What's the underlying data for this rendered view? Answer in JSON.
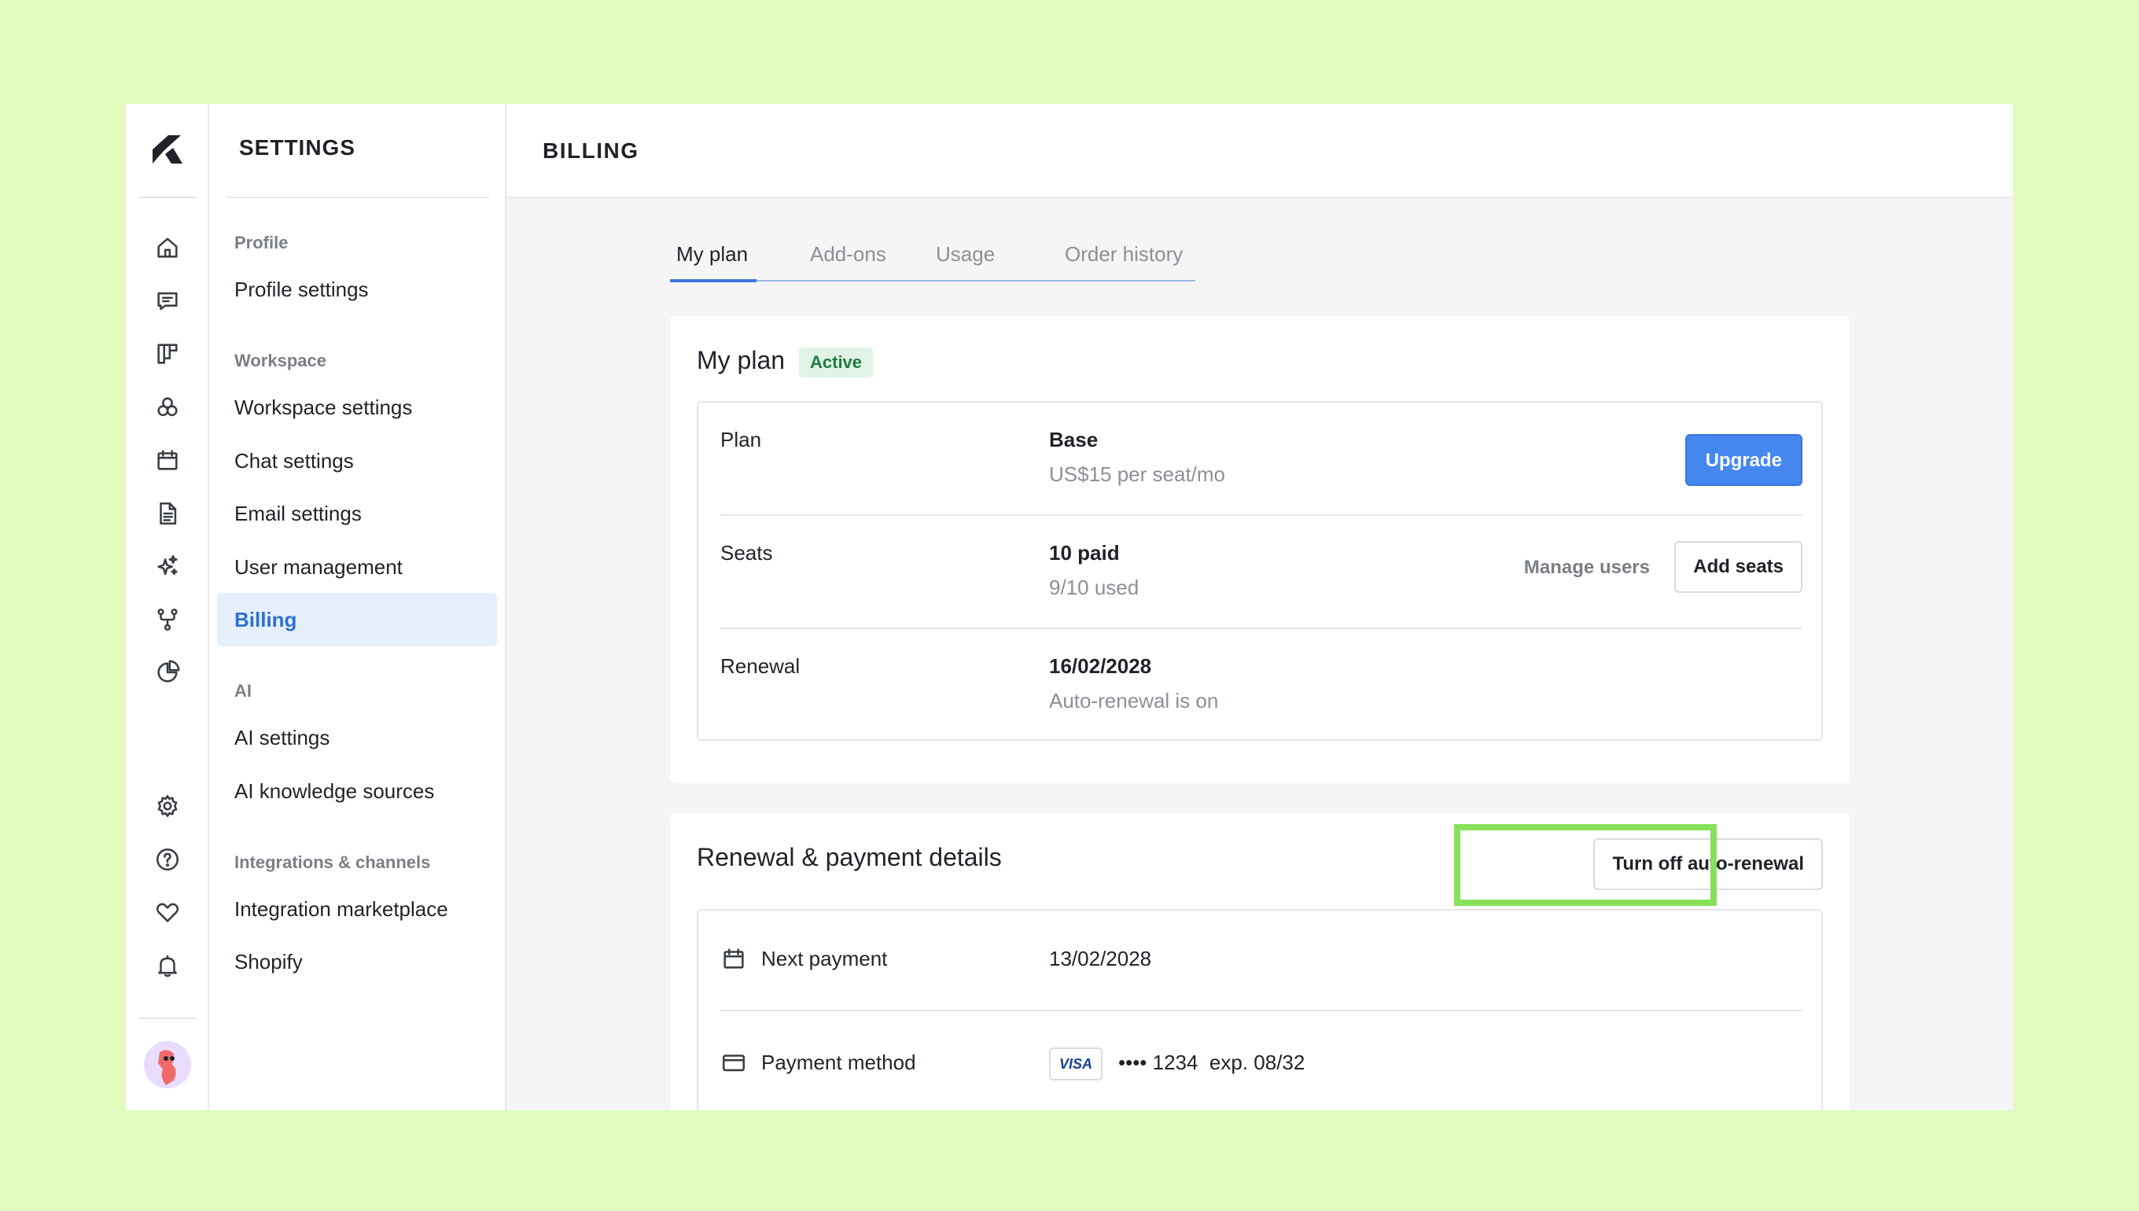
{
  "nav": {
    "title": "SETTINGS",
    "groups": [
      {
        "label": "Profile",
        "items": [
          "Profile settings"
        ]
      },
      {
        "label": "Workspace",
        "items": [
          "Workspace settings",
          "Chat settings",
          "Email settings",
          "User management",
          "Billing"
        ]
      },
      {
        "label": "AI",
        "items": [
          "AI settings",
          "AI knowledge sources"
        ]
      },
      {
        "label": "Integrations & channels",
        "items": [
          "Integration marketplace",
          "Shopify"
        ]
      }
    ],
    "active_item": "Billing"
  },
  "rail": {
    "icons": [
      "home-icon",
      "chat-icon",
      "board-icon",
      "circles-icon",
      "calendar-icon",
      "document-icon",
      "sparkles-icon",
      "workflow-icon",
      "pie-chart-icon",
      "gear-icon",
      "help-icon",
      "heart-icon",
      "bell-icon"
    ]
  },
  "header": {
    "title": "BILLING"
  },
  "tabs": [
    {
      "label": "My plan",
      "active": true
    },
    {
      "label": "Add-ons",
      "active": false
    },
    {
      "label": "Usage",
      "active": false
    },
    {
      "label": "Order history",
      "active": false
    }
  ],
  "plan_card": {
    "title": "My plan",
    "status": "Active",
    "rows": {
      "plan": {
        "label": "Plan",
        "value": "Base",
        "sub": "US$15 per seat/mo",
        "button": "Upgrade"
      },
      "seats": {
        "label": "Seats",
        "value": "10 paid",
        "sub": "9/10 used",
        "link": "Manage users",
        "button": "Add seats"
      },
      "renewal": {
        "label": "Renewal",
        "value": "16/02/2028",
        "sub": "Auto-renewal is on"
      }
    }
  },
  "payment_card": {
    "title": "Renewal & payment details",
    "button": "Turn off auto-renewal",
    "rows": {
      "next_payment": {
        "label": "Next payment",
        "value": "13/02/2028"
      },
      "payment_method": {
        "label": "Payment method",
        "brand": "VISA",
        "card": "•••• 1234  exp. 08/32"
      }
    }
  },
  "colors": {
    "accent": "#4587ee",
    "active_nav_bg": "#e6f0fd",
    "highlight": "#86e05a",
    "page_bg": "#e0fbbc"
  }
}
